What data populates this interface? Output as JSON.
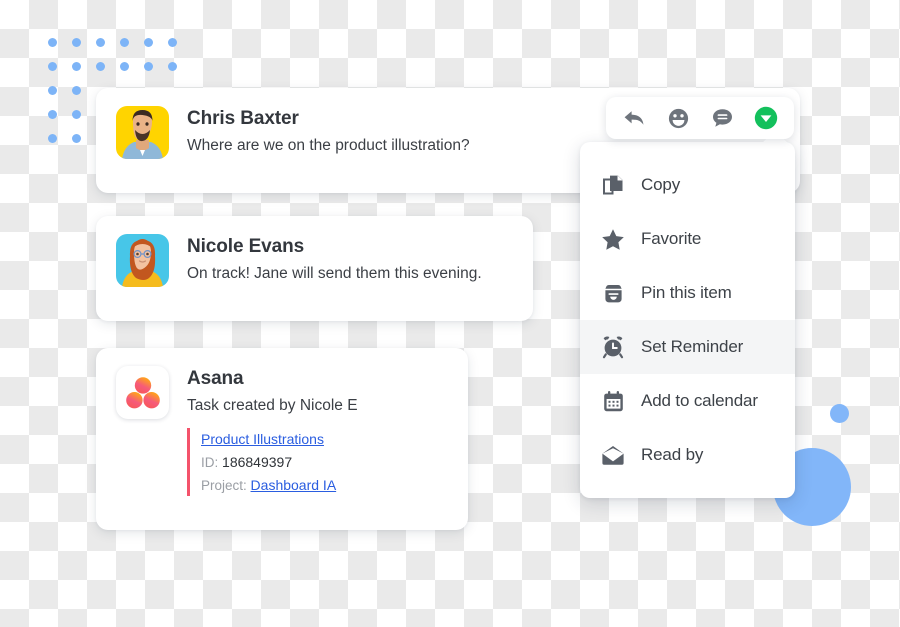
{
  "theme": {
    "accent_blue": "#82b6f9",
    "dot_blue": "#7db4f7",
    "link_blue": "#2a5de0",
    "accent_red": "#f4536b",
    "green": "#17bf4f",
    "icon_gray": "#5a6069",
    "text_dark": "#33373d",
    "text_muted": "#9a9ea4",
    "card_bg": "#ffffff",
    "menu_highlight": "#f4f5f6"
  },
  "decor": {
    "dot_grid": {
      "name": "dot-grid",
      "columns": 6,
      "rows": 5,
      "spacing": 24,
      "dot_size": 9,
      "rows_truncated_from": 3,
      "truncated_columns": 2
    },
    "big_circle": {
      "name": "big-blue-circle",
      "size": 78
    },
    "small_circle": {
      "name": "small-blue-circle",
      "size": 19
    }
  },
  "cards": [
    {
      "id": "chris-baxter-message",
      "avatar": "photo-avatar-man-yellow-bg",
      "title": "Chris Baxter",
      "subtitle": "Where are we on the product illustration?"
    },
    {
      "id": "nicole-evans-message",
      "avatar": "photo-avatar-woman-blue-bg",
      "title": "Nicole Evans",
      "subtitle": "On track! Jane will send them this evening."
    }
  ],
  "asana_card": {
    "id": "asana-task-card",
    "app_icon": "asana-logo-icon",
    "title": "Asana",
    "subtitle": "Task created by Nicole E",
    "task_link": "Product Illustrations",
    "id_label": "ID:",
    "id_value": "186849397",
    "project_label": "Project:",
    "project_link": "Dashboard IA"
  },
  "toolbar": {
    "buttons": [
      {
        "name": "reply-icon",
        "label": "Reply"
      },
      {
        "name": "emoji-icon",
        "label": "Add reaction"
      },
      {
        "name": "comment-icon",
        "label": "Comment"
      },
      {
        "name": "more-actions-icon",
        "label": "More actions"
      }
    ]
  },
  "menu": {
    "items": [
      {
        "icon": "copy-icon",
        "label": "Copy",
        "active": false
      },
      {
        "icon": "star-icon",
        "label": "Favorite",
        "active": false
      },
      {
        "icon": "archive-icon",
        "label": "Pin this item",
        "active": false
      },
      {
        "icon": "alarm-icon",
        "label": "Set Reminder",
        "active": true
      },
      {
        "icon": "calendar-icon",
        "label": "Add to calendar",
        "active": false
      },
      {
        "icon": "envelope-icon",
        "label": "Read by",
        "active": false
      }
    ]
  }
}
